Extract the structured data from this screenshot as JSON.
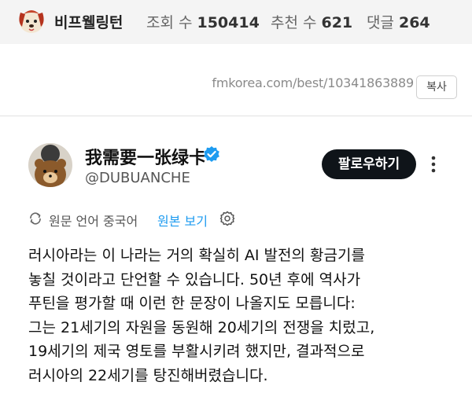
{
  "header": {
    "author": "비프웰링턴",
    "views_label": "조회 수",
    "views_value": "150414",
    "recommend_label": "추천 수",
    "recommend_value": "621",
    "comments_label": "댓글",
    "comments_value": "264"
  },
  "url_row": {
    "url": "fmkorea.com/best/10341863889",
    "copy_label": "복사"
  },
  "tweet": {
    "display_name": "我需要一张绿卡",
    "handle": "@DUBUANCHE",
    "follow_label": "팔로우하기",
    "translate_text": "원문 언어 중국어",
    "show_original_label": "원본 보기",
    "body_lines": [
      "러시아라는 이 나라는 거의 확실히 AI 발전의 황금기를",
      "놓칠 것이라고 단언할 수 있습니다. 50년 후에 역사가",
      "푸틴을 평가할 때 이런 한 문장이 나올지도 모릅니다:",
      "그는 21세기의 자원을 동원해 20세기의 전쟁을 치렀고,",
      "19세기의 제국 영토를 부활시키려 했지만, 결과적으로",
      "러시아의 22세기를 탕진해버렸습니다."
    ]
  },
  "icons": {
    "avatar": "puppy-avatar-icon",
    "verified": "verified-badge-icon",
    "more": "more-vertical-icon",
    "translate": "translate-icon",
    "settings": "gear-icon"
  },
  "colors": {
    "header_bg": "#f4f4f4",
    "follow_bg": "#0f1419",
    "link_blue": "#1d9bf0",
    "verified_blue": "#1d9bf0"
  }
}
